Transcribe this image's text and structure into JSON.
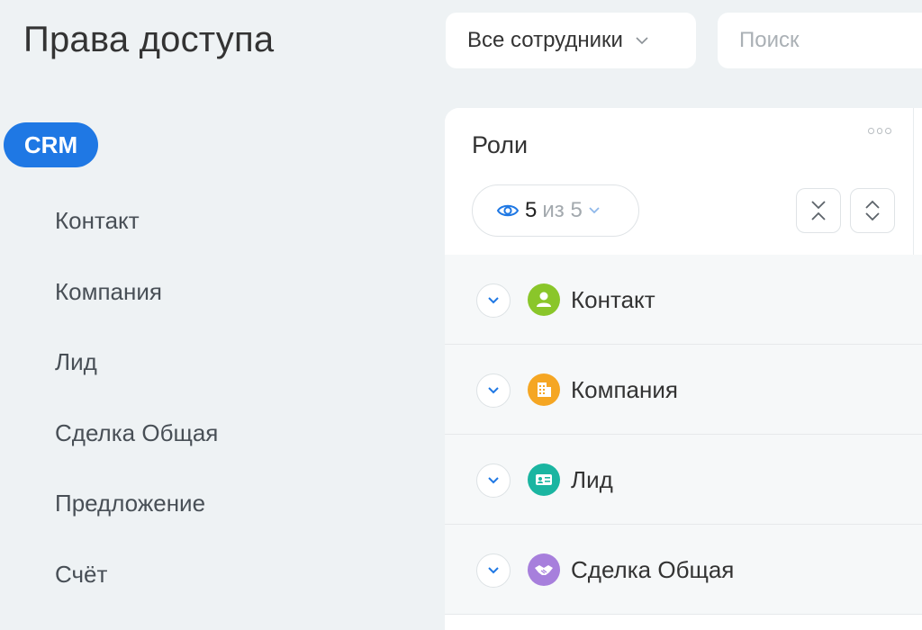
{
  "page": {
    "title": "Права доступа"
  },
  "filter": {
    "selected": "Все сотрудники"
  },
  "search": {
    "placeholder": "Поиск",
    "value": ""
  },
  "sidebar": {
    "section": "CRM",
    "items": [
      {
        "label": "Контакт"
      },
      {
        "label": "Компания"
      },
      {
        "label": "Лид"
      },
      {
        "label": "Сделка Общая"
      },
      {
        "label": "Предложение"
      },
      {
        "label": "Счёт"
      }
    ]
  },
  "roles_panel": {
    "title": "Роли",
    "visibility": {
      "shown": "5",
      "of_text": "из 5"
    },
    "entities": [
      {
        "label": "Контакт",
        "icon": "person-icon",
        "color": "#8ac62a"
      },
      {
        "label": "Компания",
        "icon": "building-icon",
        "color": "#f5a623"
      },
      {
        "label": "Лид",
        "icon": "id-card-icon",
        "color": "#1ab5a1"
      },
      {
        "label": "Сделка Общая",
        "icon": "handshake-icon",
        "color": "#a77fdc"
      }
    ]
  },
  "colors": {
    "accent": "#1f78e4",
    "background": "#eef2f4"
  }
}
